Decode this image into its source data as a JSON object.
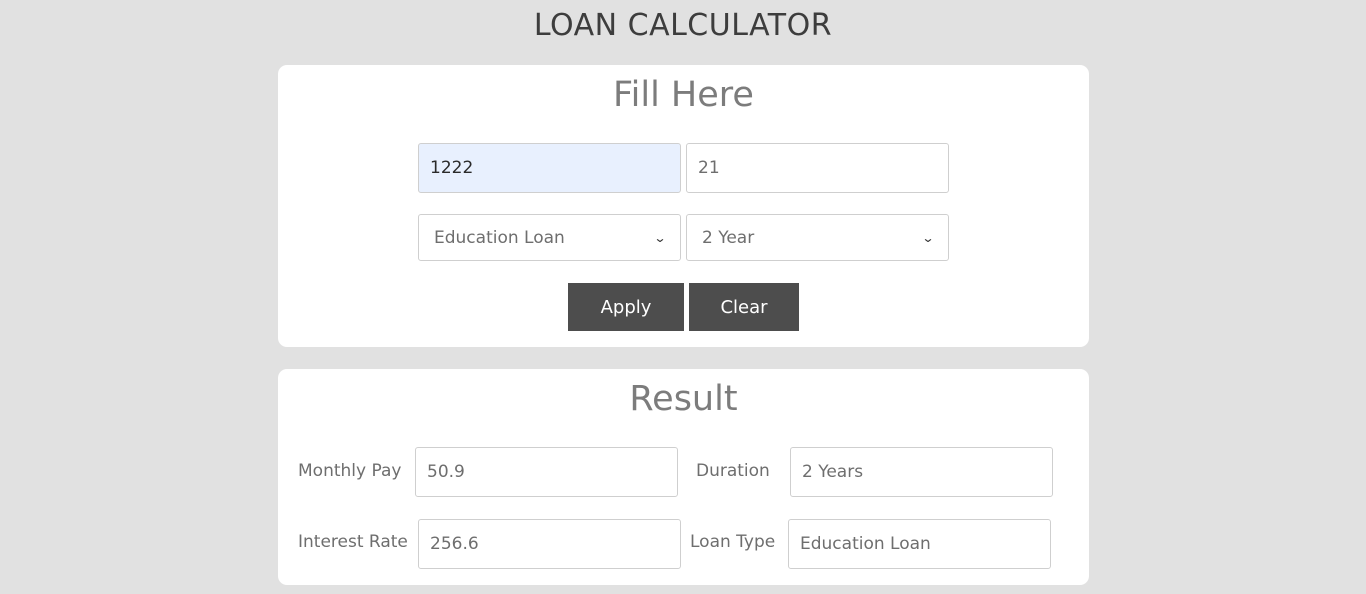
{
  "header": {
    "title": "LOAN CALCULATOR"
  },
  "fill": {
    "heading": "Fill Here",
    "amount_value": "1222",
    "rate_value": "21",
    "loan_type_selected": "Education Loan",
    "duration_selected": "2 Year",
    "apply_label": "Apply",
    "clear_label": "Clear"
  },
  "result": {
    "heading": "Result",
    "monthly_pay_label": "Monthly Pay",
    "monthly_pay_value": "50.9",
    "duration_label": "Duration",
    "duration_value": "2 Years",
    "interest_rate_label": "Interest Rate",
    "interest_rate_value": "256.6",
    "loan_type_label": "Loan Type",
    "loan_type_value": "Education Loan"
  },
  "colors": {
    "background": "#e1e1e1",
    "card": "#ffffff",
    "button": "#4d4d4d",
    "autofill": "#e8f0fe"
  }
}
